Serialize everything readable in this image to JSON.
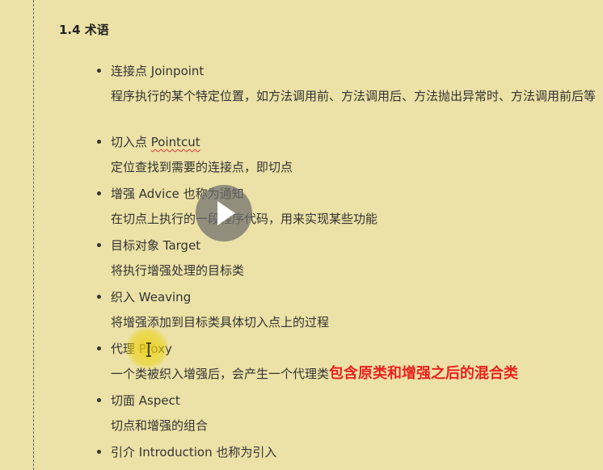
{
  "heading": "1.4 术语",
  "terms": [
    {
      "title": "连接点 Joinpoint",
      "description": "程序执行的某个特定位置，如方法调用前、方法调用后、方法抛出异常时、方法调用前后等"
    },
    {
      "title_prefix": "切入点 ",
      "title_word": "Pointcut",
      "description": "定位查找到需要的连接点，即切点"
    },
    {
      "title": "增强 Advice 也称为通知",
      "description": "在切点上执行的一段程序代码，用来实现某些功能"
    },
    {
      "title": "目标对象 Target",
      "description": "将执行增强处理的目标类"
    },
    {
      "title": "织入 Weaving",
      "description": "将增强添加到目标类具体切入点上的过程"
    },
    {
      "title": "代理 Proxy",
      "description": "一个类被织入增强后，会产生一个代理类",
      "highlight": "包含原类和增强之后的混合类"
    },
    {
      "title": "切面 Aspect",
      "description": "切点和增强的组合"
    },
    {
      "title": "引介 Introduction 也称为引入"
    }
  ],
  "colors": {
    "background": "#ece1a6",
    "highlight": "#e8231f",
    "text": "#333333"
  },
  "icons": {
    "overlay": "play-icon",
    "cursor": "text-cursor-icon"
  }
}
